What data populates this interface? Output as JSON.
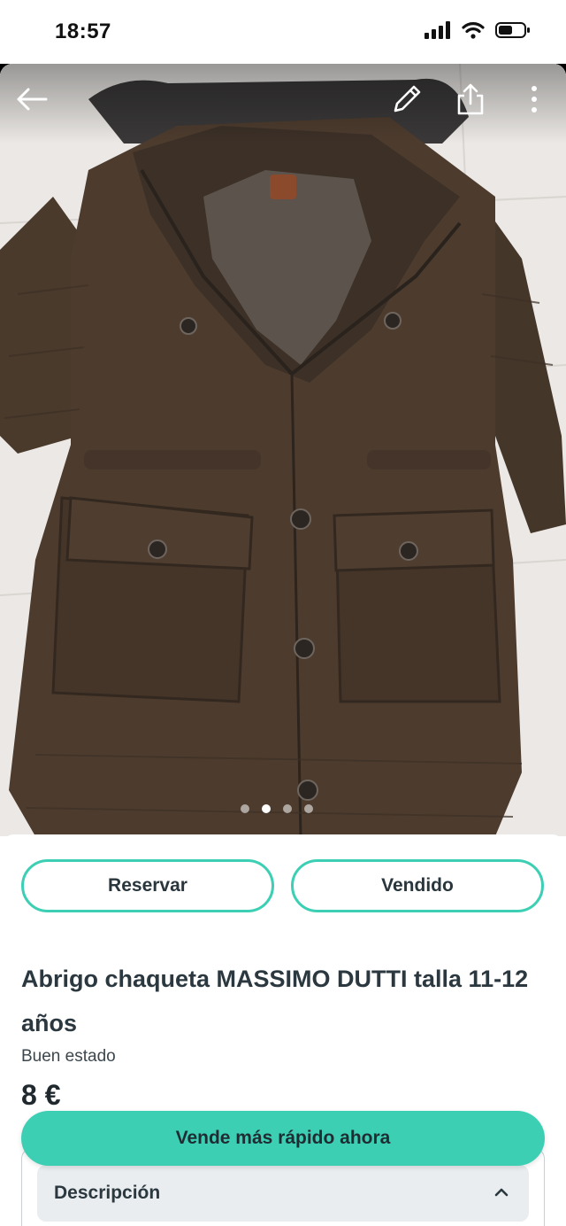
{
  "status_bar": {
    "time": "18:57"
  },
  "gallery": {
    "slide_count": 4,
    "active_slide": 2
  },
  "actions": {
    "reserve_label": "Reservar",
    "sold_label": "Vendido"
  },
  "product": {
    "title": "Abrigo chaqueta MASSIMO DUTTI talla 11-12 años",
    "condition": "Buen estado",
    "price": "8 €"
  },
  "description": {
    "header": "Descripción"
  },
  "boost": {
    "label": "Vende más rápido ahora"
  },
  "colors": {
    "accent": "#3ccfb4",
    "jacket": "#4a3a2c"
  }
}
